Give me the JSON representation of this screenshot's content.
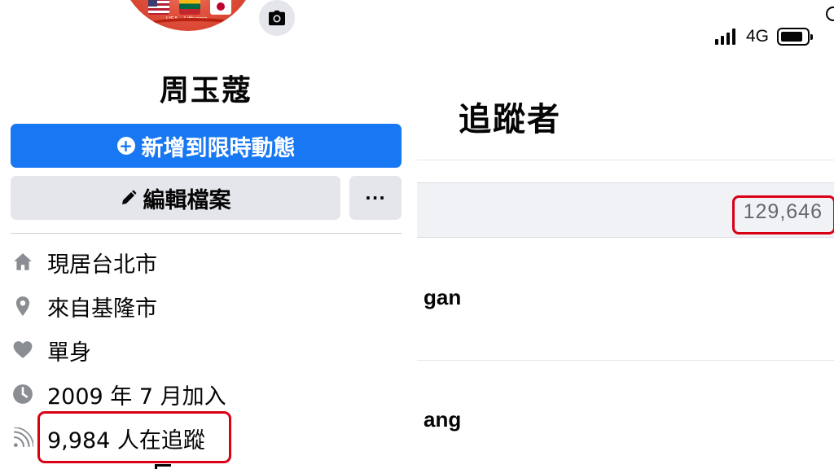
{
  "profile": {
    "name": "周玉蔻",
    "avatar_flag_labels": [
      "USA",
      "Lithuania",
      "Japan"
    ]
  },
  "actions": {
    "add_story_label": "新增到限時動態",
    "edit_profile_label": "編輯檔案",
    "more_label": "···"
  },
  "intro": {
    "lives_in": "現居台北市",
    "from": "來自基隆市",
    "relationship": "單身",
    "joined": "2009 年 7 月加入",
    "followers": "9,984 人在追蹤"
  },
  "status_bar": {
    "network": "4G"
  },
  "followers_page": {
    "title": "追蹤者",
    "count": "129,646",
    "items": [
      "gan",
      "ang"
    ]
  },
  "colors": {
    "primary_blue": "#1877f2",
    "secondary_gray": "#e4e6eb",
    "highlight_red": "#d90016",
    "muted_text": "#65676b"
  },
  "icons": [
    "camera-icon",
    "plus-circle-icon",
    "pencil-icon",
    "home-icon",
    "location-pin-icon",
    "heart-icon",
    "clock-icon",
    "rss-feed-icon",
    "signal-icon",
    "battery-icon"
  ]
}
